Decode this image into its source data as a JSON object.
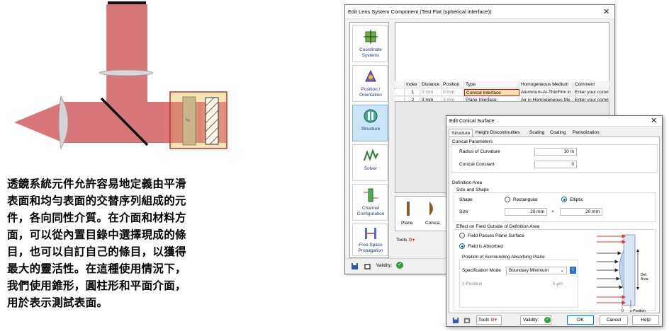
{
  "description_zh": [
    "透鏡系統元件允許容易地定義由平滑",
    "表面和均勻表面的交替序列組成的元",
    "件，各向同性介質。在介面和材料方",
    "面，可以從內置目錄中選擇現成的條",
    "目，也可以自訂自己的條目，以獲得",
    "最大的靈活性。在這種使用情況下，",
    "我們使用錐形，圓柱形和平面介面，",
    "用於表示測試表面。"
  ],
  "lens_dialog": {
    "title": "Edit Lens System Component (Test Flat  (spherical interface))",
    "close": "✕",
    "sidebar": [
      {
        "label": "Coordinate Systems",
        "icon": "coordinate-systems-icon"
      },
      {
        "label": "Position / Orientation",
        "icon": "position-orientation-icon"
      },
      {
        "label": "Structure",
        "icon": "structure-icon",
        "selected": true
      },
      {
        "label": "Solver",
        "icon": "solver-icon"
      },
      {
        "label": "Channel Configuration",
        "icon": "channel-configuration-icon"
      },
      {
        "label": "Free Space Propagation",
        "icon": "free-space-propagation-icon"
      }
    ],
    "table": {
      "headers": [
        "Index",
        "Distance",
        "Position",
        "Type",
        "Homogeneous Medium",
        "Comment"
      ],
      "rows": [
        [
          "1",
          "0 mm",
          "0 mm",
          "Conical Interface",
          "Aluminum-Al-ThinFilm in",
          "Enter your comm"
        ],
        [
          "2",
          "3 mm",
          "3 mm",
          "Plane Interface",
          "Air in Homogeneous Me",
          "Enter your comm"
        ]
      ]
    },
    "library": [
      {
        "label": "Plane"
      },
      {
        "label": "Conica"
      }
    ],
    "tools_label": "Tools",
    "validity_label": "Validity:"
  },
  "conical_dialog": {
    "title": "Edit Conical Surface",
    "close": "✕",
    "tabs": [
      "Structure",
      "Height Discontinuities",
      "Scaling",
      "Coating",
      "Periodization"
    ],
    "conical_parameters": {
      "heading": "Conical Parameters",
      "radius_label": "Radius of Curvature",
      "radius_value": "10 m",
      "constant_label": "Conical Constant",
      "constant_value": "0"
    },
    "definition_area": {
      "heading": "Definition Area",
      "size_shape_heading": "Size and Shape",
      "shape_label": "Shape",
      "shape_options": [
        "Rectangular",
        "Elliptic"
      ],
      "shape_selected": "Elliptic",
      "size_label": "Size",
      "size_x": "20 mm",
      "size_sep": "×",
      "size_y": "20 mm"
    },
    "effect": {
      "heading": "Effect on Field Outside of Definition Area",
      "options": [
        "Field Passes Plane Surface",
        "Field is Absorbed"
      ],
      "selected": "Field is Absorbed",
      "position_heading": "Position of Surrounding Absorbing Plane",
      "spec_mode_label": "Specification Mode",
      "spec_mode_value": "Boundary Minimum",
      "info": "i",
      "z_label": "z-Position",
      "z_value": "5 µm"
    },
    "figure": {
      "def_area": "Def. Area",
      "zero": "0",
      "z_position": "z-Position"
    },
    "footer": {
      "tools": "Tools",
      "validity": "Validity:",
      "ok": "OK",
      "cancel": "Cancel",
      "help": "Help"
    }
  },
  "colors": {
    "beam": "#c94a4f",
    "highlight_box": "#f6e2a8",
    "highlight_border": "#b41e1e",
    "selected_tab": "#cce4f7",
    "accent": "#0078d4",
    "valid": "#2e9e3e"
  }
}
